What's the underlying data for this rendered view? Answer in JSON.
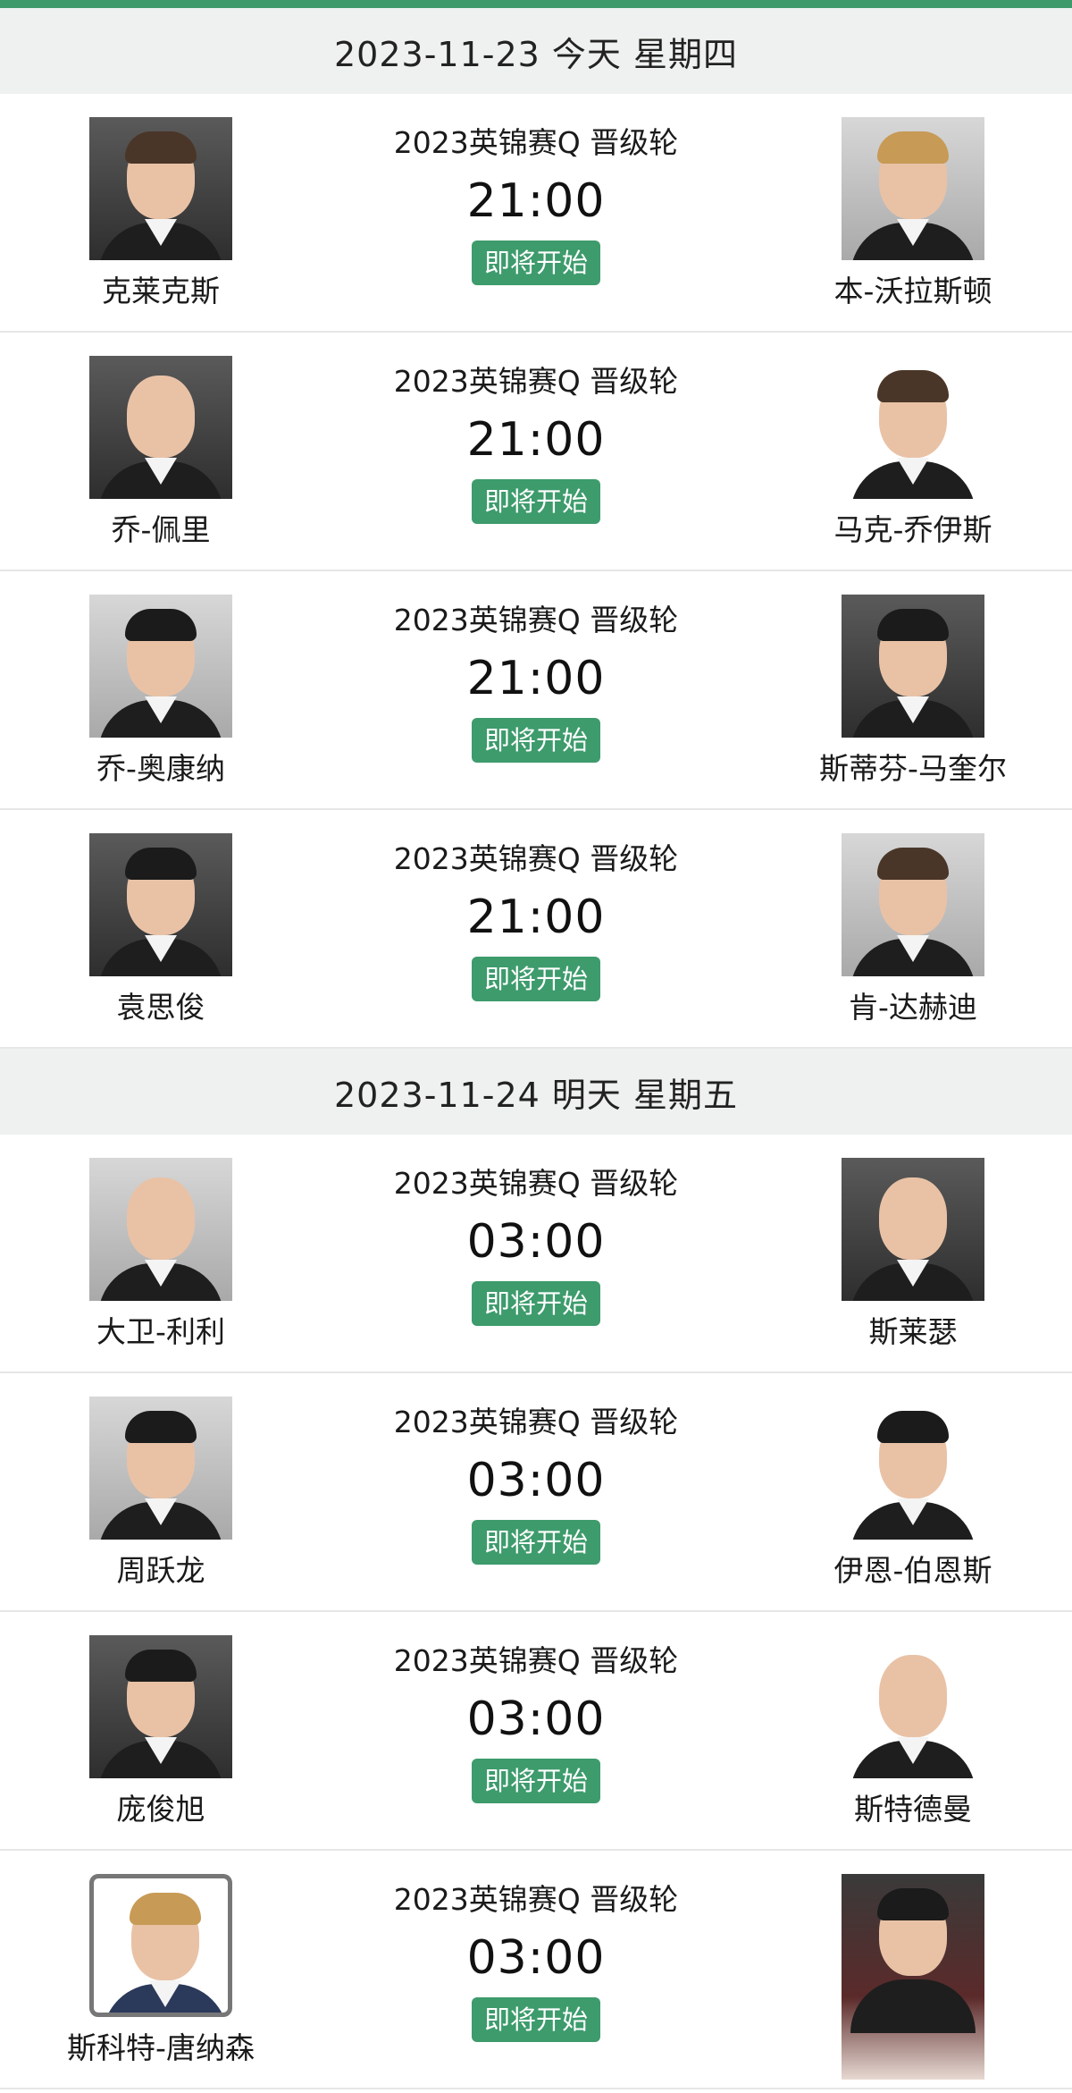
{
  "days": [
    {
      "date_label": "2023-11-23 今天 星期四",
      "matches": [
        {
          "event": "2023英锦赛Q 晋级轮",
          "time": "21:00",
          "status": "即将开始",
          "home": "克莱克斯",
          "away": "本-沃拉斯顿"
        },
        {
          "event": "2023英锦赛Q 晋级轮",
          "time": "21:00",
          "status": "即将开始",
          "home": "乔-佩里",
          "away": "马克-乔伊斯"
        },
        {
          "event": "2023英锦赛Q 晋级轮",
          "time": "21:00",
          "status": "即将开始",
          "home": "乔-奥康纳",
          "away": "斯蒂芬-马奎尔"
        },
        {
          "event": "2023英锦赛Q 晋级轮",
          "time": "21:00",
          "status": "即将开始",
          "home": "袁思俊",
          "away": "肯-达赫迪"
        }
      ]
    },
    {
      "date_label": "2023-11-24 明天 星期五",
      "matches": [
        {
          "event": "2023英锦赛Q 晋级轮",
          "time": "03:00",
          "status": "即将开始",
          "home": "大卫-利利",
          "away": "斯莱瑟"
        },
        {
          "event": "2023英锦赛Q 晋级轮",
          "time": "03:00",
          "status": "即将开始",
          "home": "周跃龙",
          "away": "伊恩-伯恩斯"
        },
        {
          "event": "2023英锦赛Q 晋级轮",
          "time": "03:00",
          "status": "即将开始",
          "home": "庞俊旭",
          "away": "斯特德曼"
        },
        {
          "event": "2023英锦赛Q 晋级轮",
          "time": "03:00",
          "status": "即将开始",
          "home": "斯科特-唐纳森",
          "away": ""
        }
      ]
    }
  ],
  "colors": {
    "accent": "#3f9a6b",
    "badge": "#3d9b6c",
    "header_bg": "#eef1ef"
  }
}
